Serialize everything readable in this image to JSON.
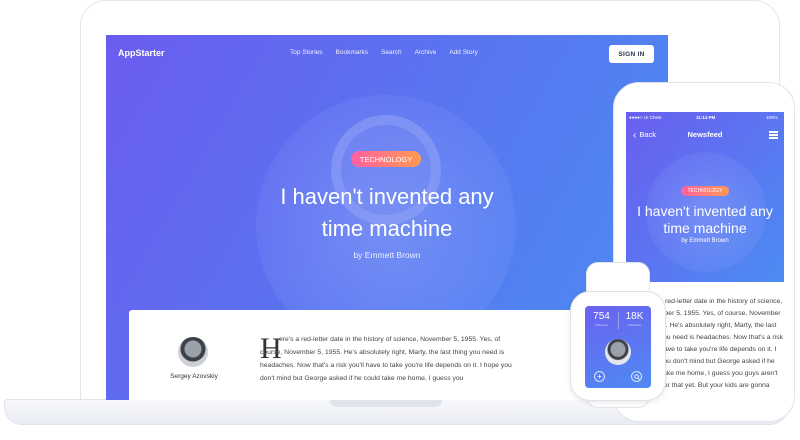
{
  "desktop": {
    "brand": "AppStarter",
    "nav": [
      "Top Stories",
      "Bookmarks",
      "Search",
      "Archive",
      "Add Story"
    ],
    "signin_label": "SIGN IN",
    "badge": "TECHNOLOGY",
    "title": "I haven't invented any time machine",
    "byline": "by Emmett Brown",
    "author_name": "Sergey Azovskiy",
    "dropcap": "H",
    "article_text": "ere's a red-letter date in the history of science, November 5, 1955. Yes, of course, November 5, 1955. He's absolutely right, Marty, the last thing you need is headaches. Now that's a risk you'll have to take you're life depends on it. I hope you don't mind but George asked if he could take me home, I guess you"
  },
  "phone": {
    "status": {
      "carrier": "UI Chest",
      "time": "11:14 PM",
      "battery": "100%"
    },
    "back_label": "Back",
    "title": "Newsfeed",
    "badge": "TECHNOLOGY",
    "hero_title": "I haven't invented any time machine",
    "byline": "by Emmett Brown",
    "article_text": "ere's a red-letter date in the history of science, November 5, 1955. Yes, of course, November 5, 1955. He's absolutely right, Marty, the last thing you need is headaches. Now that's a risk you'll have to take you're life depends on it. I hope you don't mind but George asked if he could take me home, I guess you guys aren't ready for that yet. But your kids are gonna love"
  },
  "watch": {
    "stats": [
      {
        "value": "754",
        "label": "Followers"
      },
      {
        "value": "18K",
        "label": "Followers"
      }
    ],
    "add_icon": "+",
    "search_icon": "search-icon"
  },
  "colors": {
    "gradient_start": "#6b5cf0",
    "gradient_end": "#4a8ff2",
    "badge_start": "#ff5fa0",
    "badge_end": "#ff9a52"
  }
}
